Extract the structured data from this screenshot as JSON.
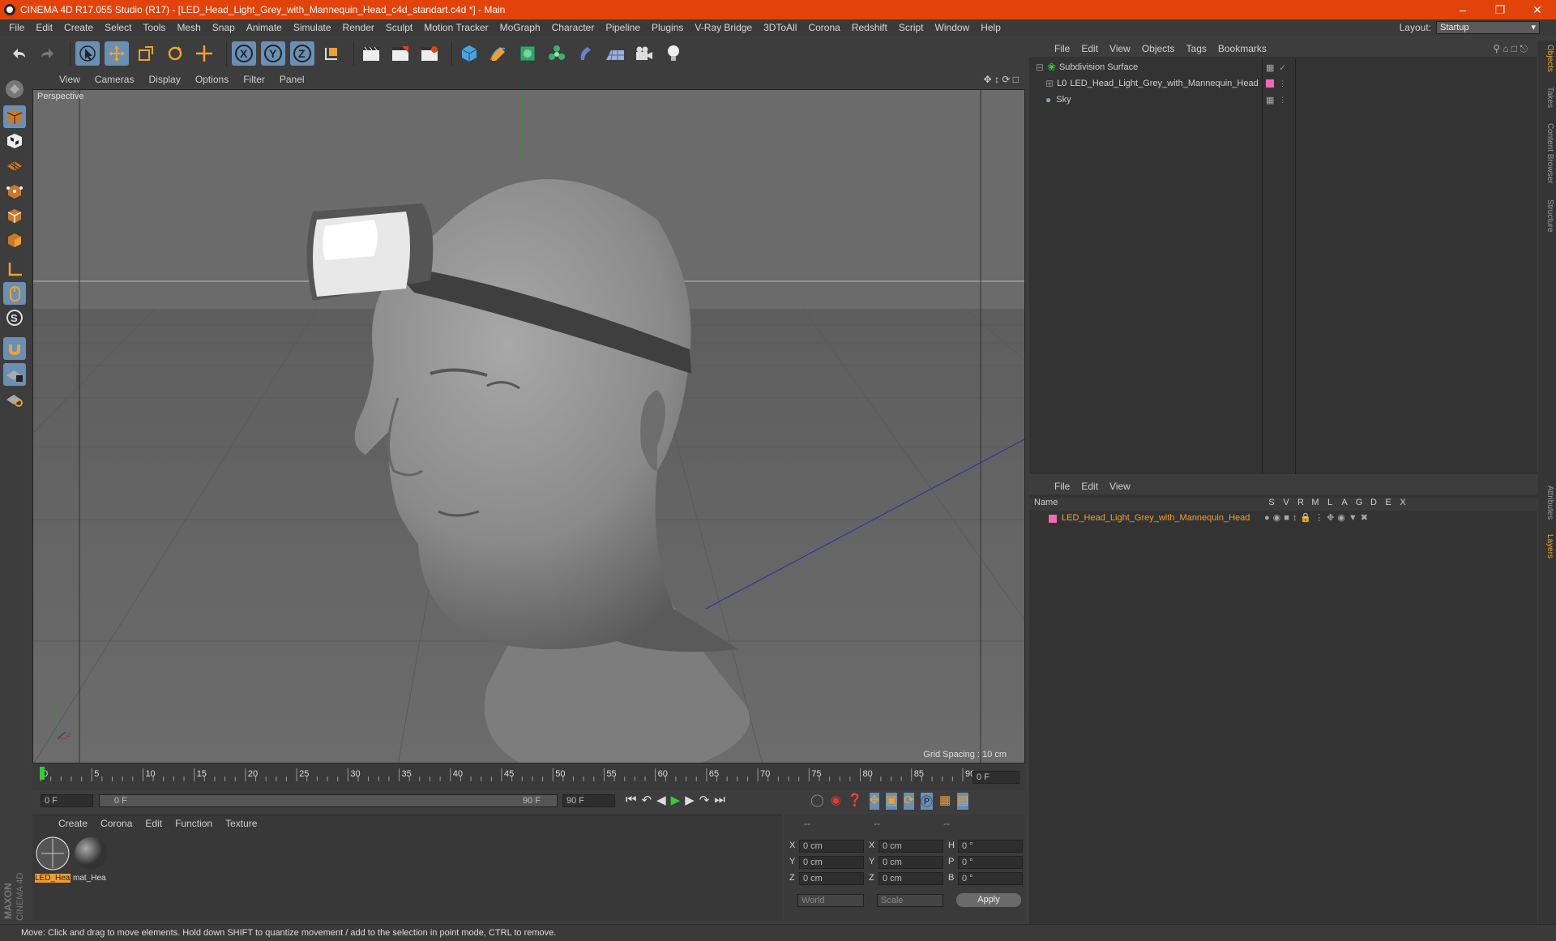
{
  "window": {
    "title": "CINEMA 4D R17.055 Studio (R17) - [LED_Head_Light_Grey_with_Mannequin_Head_c4d_standart.c4d *] - Main"
  },
  "menubar": {
    "items": [
      "File",
      "Edit",
      "Create",
      "Select",
      "Tools",
      "Mesh",
      "Snap",
      "Animate",
      "Simulate",
      "Render",
      "Sculpt",
      "Motion Tracker",
      "MoGraph",
      "Character",
      "Pipeline",
      "Plugins",
      "V-Ray Bridge",
      "3DToAll",
      "Corona",
      "Redshift",
      "Script",
      "Window",
      "Help"
    ]
  },
  "layout": {
    "label": "Layout:",
    "value": "Startup"
  },
  "viewport": {
    "menu": [
      "View",
      "Cameras",
      "Display",
      "Options",
      "Filter",
      "Panel"
    ],
    "label": "Perspective",
    "grid_spacing": "Grid Spacing : 10 cm"
  },
  "timeline": {
    "ticks": [
      "0",
      "5",
      "10",
      "15",
      "20",
      "25",
      "30",
      "35",
      "40",
      "45",
      "50",
      "55",
      "60",
      "65",
      "70",
      "75",
      "80",
      "85",
      "90"
    ],
    "current_frame": "0 F",
    "start_field": "0 F",
    "range_start": "0 F",
    "range_end": "90 F",
    "end_field": "90 F"
  },
  "materials": {
    "menu": [
      "Create",
      "Corona",
      "Edit",
      "Function",
      "Texture"
    ],
    "items": [
      {
        "name": "LED_Hea"
      },
      {
        "name": "mat_Hea"
      }
    ]
  },
  "coords": {
    "headers": [
      "--",
      "--",
      "--"
    ],
    "rows": [
      {
        "a": "X",
        "av": "0 cm",
        "b": "X",
        "bv": "0 cm",
        "c": "H",
        "cv": "0 °"
      },
      {
        "a": "Y",
        "av": "0 cm",
        "b": "Y",
        "bv": "0 cm",
        "c": "P",
        "cv": "0 °"
      },
      {
        "a": "Z",
        "av": "0 cm",
        "b": "Z",
        "bv": "0 cm",
        "c": "B",
        "cv": "0 °"
      }
    ],
    "world": "World",
    "scale": "Scale",
    "apply": "Apply"
  },
  "objects": {
    "menu": [
      "File",
      "Edit",
      "View",
      "Objects",
      "Tags",
      "Bookmarks"
    ],
    "items": [
      {
        "name": "Subdivision Surface"
      },
      {
        "name": "LED_Head_Light_Grey_with_Mannequin_Head"
      },
      {
        "name": "Sky"
      }
    ]
  },
  "layers": {
    "menu": [
      "File",
      "Edit",
      "View"
    ],
    "header_name": "Name",
    "cols": [
      "S",
      "V",
      "R",
      "M",
      "L",
      "A",
      "G",
      "D",
      "E",
      "X"
    ],
    "row": {
      "name": "LED_Head_Light_Grey_with_Mannequin_Head"
    }
  },
  "right_tabs": [
    "Objects",
    "Takes",
    "Content Browser",
    "Structure",
    "Attributes",
    "Layers"
  ],
  "status": "Move: Click and drag to move elements. Hold down SHIFT to quantize movement / add to the selection in point mode, CTRL to remove.",
  "brand": {
    "line1": "MAXON",
    "line2": "CINEMA 4D"
  },
  "colors": {
    "title_bar": "#e2430b",
    "layer_color": "#f06ab0",
    "accent_orange": "#f0a030"
  }
}
